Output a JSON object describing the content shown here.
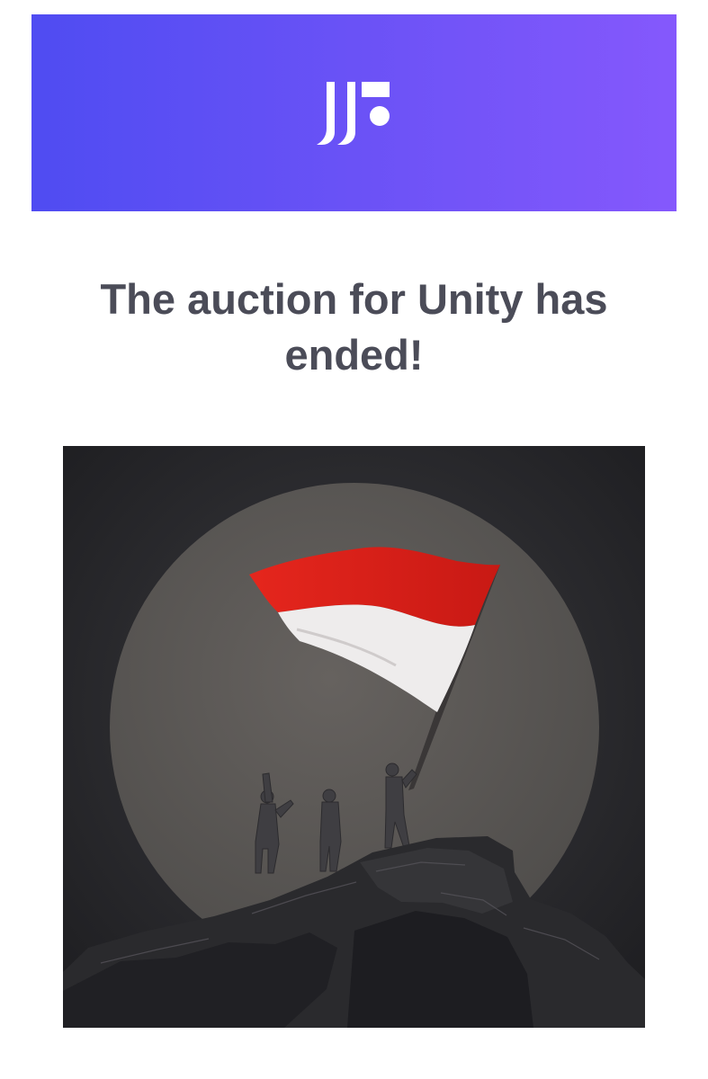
{
  "header": {
    "logo_icon": "brand-logo-icon",
    "gradient_start": "#4f4cf2",
    "gradient_end": "#8558fc"
  },
  "headline": {
    "text": "The auction for Unity has ended!"
  },
  "artwork": {
    "icon": "artwork-image",
    "subject": "people raising a red and white flag on a rock before a large moon",
    "flag_colors": [
      "#e2231a",
      "#f0eeee"
    ],
    "moon_color": "#5f5c5a",
    "background_color": "#222225"
  }
}
